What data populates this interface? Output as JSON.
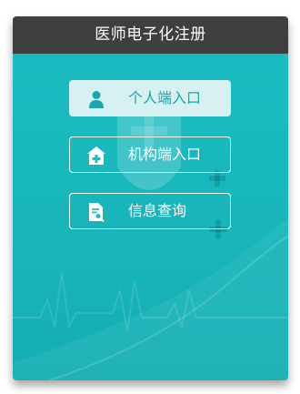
{
  "title": "医师电子化注册",
  "entries": [
    {
      "label": "个人端入口",
      "icon": "person-icon",
      "active": true
    },
    {
      "label": "机构端入口",
      "icon": "hospital-icon",
      "active": false
    },
    {
      "label": "信息查询",
      "icon": "document-search-icon",
      "active": false
    }
  ],
  "colors": {
    "titlebar": "#3f3f3f",
    "panel": "#1bbec3",
    "active_button_bg": "#d7f1f2",
    "active_button_text": "#1aa6ab"
  }
}
